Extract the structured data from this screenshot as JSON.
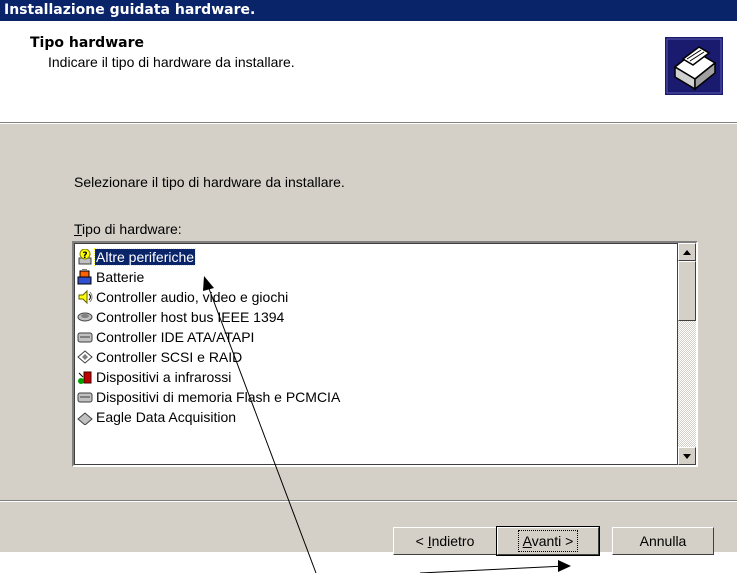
{
  "window": {
    "title": "Installazione guidata hardware."
  },
  "header": {
    "title": "Tipo hardware",
    "subtitle": "Indicare il tipo di hardware da installare."
  },
  "main": {
    "instruction": "Selezionare il tipo di hardware da installare.",
    "list_label_mnemonic": "T",
    "list_label_rest": "ipo di hardware:",
    "items": [
      {
        "label": "Altre periferiche",
        "icon": "question-device-icon",
        "selected": true
      },
      {
        "label": "Batterie",
        "icon": "battery-icon"
      },
      {
        "label": "Controller audio, video e giochi",
        "icon": "speaker-icon"
      },
      {
        "label": "Controller host bus IEEE 1394",
        "icon": "firewire-icon"
      },
      {
        "label": "Controller IDE ATA/ATAPI",
        "icon": "ide-controller-icon"
      },
      {
        "label": "Controller SCSI e RAID",
        "icon": "scsi-icon"
      },
      {
        "label": "Dispositivi a infrarossi",
        "icon": "infrared-icon"
      },
      {
        "label": "Dispositivi di memoria Flash e PCMCIA",
        "icon": "flash-memory-icon"
      },
      {
        "label": "Eagle Data Acquisition",
        "icon": "daq-icon"
      }
    ]
  },
  "buttons": {
    "back_prefix": "< ",
    "back_mnemonic": "I",
    "back_rest": "ndietro",
    "next_mnemonic": "A",
    "next_rest": "vanti >",
    "cancel": "Annulla"
  },
  "colors": {
    "titlebar": "#0a246a",
    "dialog_face": "#d4d0c8",
    "selection": "#0a246a"
  }
}
